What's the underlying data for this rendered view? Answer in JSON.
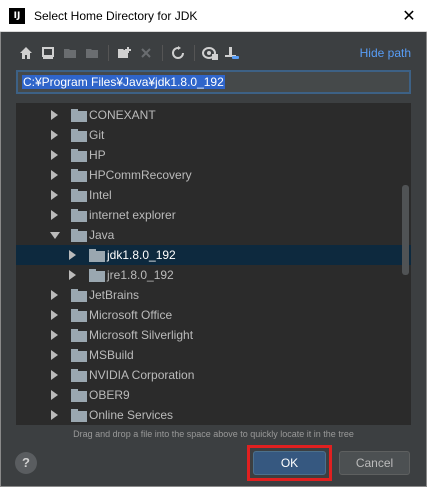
{
  "window": {
    "title": "Select Home Directory for JDK",
    "app_icon_label": "IJ",
    "close_icon": "close-icon"
  },
  "toolbar": {
    "buttons": [
      "home-icon",
      "desktop-icon",
      "project-folder-icon",
      "module-folder-icon",
      "new-folder-icon",
      "delete-icon",
      "refresh-icon",
      "show-hidden-icon",
      "attach-icon"
    ],
    "hide_path_label": "Hide path"
  },
  "path_field": {
    "value": "C:¥Program Files¥Java¥jdk1.8.0_192"
  },
  "tree": {
    "rows": [
      {
        "label": "CONEXANT",
        "expanded": false,
        "selected": false,
        "depth": 0
      },
      {
        "label": "Git",
        "expanded": false,
        "selected": false,
        "depth": 0
      },
      {
        "label": "HP",
        "expanded": false,
        "selected": false,
        "depth": 0
      },
      {
        "label": "HPCommRecovery",
        "expanded": false,
        "selected": false,
        "depth": 0
      },
      {
        "label": "Intel",
        "expanded": false,
        "selected": false,
        "depth": 0
      },
      {
        "label": "internet explorer",
        "expanded": false,
        "selected": false,
        "depth": 0
      },
      {
        "label": "Java",
        "expanded": true,
        "selected": false,
        "depth": 0
      },
      {
        "label": "jdk1.8.0_192",
        "expanded": false,
        "selected": true,
        "depth": 1
      },
      {
        "label": "jre1.8.0_192",
        "expanded": false,
        "selected": false,
        "depth": 1
      },
      {
        "label": "JetBrains",
        "expanded": false,
        "selected": false,
        "depth": 0
      },
      {
        "label": "Microsoft Office",
        "expanded": false,
        "selected": false,
        "depth": 0
      },
      {
        "label": "Microsoft Silverlight",
        "expanded": false,
        "selected": false,
        "depth": 0
      },
      {
        "label": "MSBuild",
        "expanded": false,
        "selected": false,
        "depth": 0
      },
      {
        "label": "NVIDIA Corporation",
        "expanded": false,
        "selected": false,
        "depth": 0
      },
      {
        "label": "OBER9",
        "expanded": false,
        "selected": false,
        "depth": 0
      },
      {
        "label": "Online Services",
        "expanded": false,
        "selected": false,
        "depth": 0
      }
    ]
  },
  "hint_text": "Drag and drop a file into the space above to quickly locate it in the tree",
  "footer": {
    "help_label": "?",
    "ok_label": "OK",
    "cancel_label": "Cancel"
  },
  "colors": {
    "background": "#3c3f41",
    "tree_background": "#2b2b2b",
    "selection": "#0d293e",
    "accent_link": "#589df6",
    "ok_button": "#365880",
    "highlight_box": "#e02020"
  }
}
